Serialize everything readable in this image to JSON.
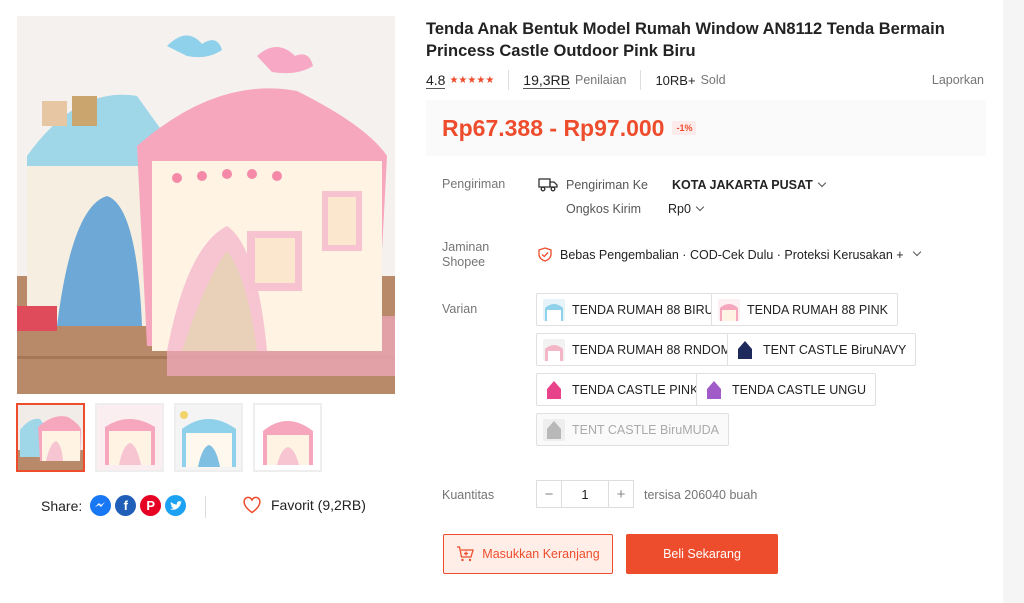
{
  "product": {
    "title": "Tenda Anak Bentuk Model Rumah Window AN8112 Tenda Bermain Princess Castle Outdoor Pink Biru",
    "rating": "4.8",
    "rating_stars": "★★★★★",
    "review_count": "19,3RB",
    "review_label": "Penilaian",
    "sold_count": "10RB+",
    "sold_label": "Sold",
    "report_label": "Laporkan",
    "price": "Rp67.388 - Rp97.000",
    "discount": "-1%"
  },
  "gallery": {
    "thumbnail_count": 4,
    "active_thumbnail": 1
  },
  "share": {
    "label": "Share:",
    "networks": [
      "messenger",
      "facebook",
      "pinterest",
      "twitter"
    ]
  },
  "favorite": {
    "label": "Favorit (9,2RB)"
  },
  "shipping": {
    "label": "Pengiriman",
    "to_label": "Pengiriman Ke",
    "destination": "KOTA JAKARTA PUSAT",
    "cost_label": "Ongkos Kirim",
    "cost_value": "Rp0"
  },
  "guarantee": {
    "label_line1": "Jaminan",
    "label_line2": "Shopee",
    "text": "Bebas Pengembalian · COD-Cek Dulu · Proteksi Kerusakan +"
  },
  "variants": {
    "label": "Varian",
    "items": [
      {
        "label": "TENDA RUMAH 88 BIRU",
        "thumb": "blue-house"
      },
      {
        "label": "TENDA RUMAH 88 PINK",
        "thumb": "pink-house"
      },
      {
        "label": "TENDA RUMAH 88 RNDOM",
        "thumb": "random-house"
      },
      {
        "label": "TENT CASTLE BiruNAVY",
        "thumb": "navy-castle"
      },
      {
        "label": "TENDA CASTLE PINK",
        "thumb": "pink-castle"
      },
      {
        "label": "TENDA CASTLE UNGU",
        "thumb": "purple-castle"
      },
      {
        "label": "TENT CASTLE BiruMUDA",
        "thumb": "lightblue-castle",
        "disabled": true
      }
    ]
  },
  "quantity": {
    "label": "Kuantitas",
    "minus": "−",
    "value": "1",
    "plus": "+",
    "stock": "tersisa 206040 buah"
  },
  "actions": {
    "add_to_cart": "Masukkan Keranjang",
    "buy_now": "Beli Sekarang"
  },
  "colors": {
    "accent": "#ee4d2d",
    "messenger": "#1877f2",
    "facebook": "#1877f2",
    "pinterest": "#e60023",
    "twitter": "#1da1f2"
  }
}
